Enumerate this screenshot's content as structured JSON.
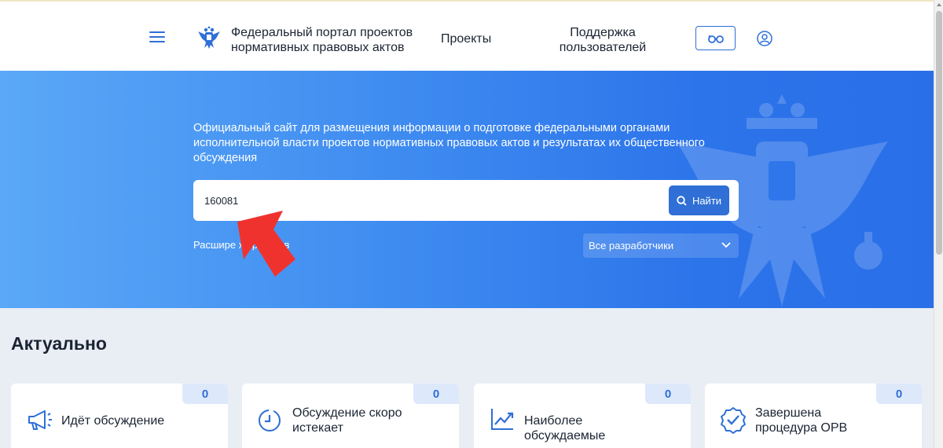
{
  "header": {
    "portal_title": "Федеральный портал проектов нормативных правовых актов",
    "nav_projects": "Проекты",
    "nav_support": "Поддержка пользователей"
  },
  "hero": {
    "description": "Официальный сайт для размещения информации о подготовке федеральными органами исполнительной власти проектов нормативных правовых актов и результатах их общественного обсуждения",
    "search_value": "160081",
    "search_button": "Найти",
    "advanced_link_visible": "Расшире                    х проектов",
    "developer_select": "Все разработчики"
  },
  "actual": {
    "title": "Актуально",
    "cards": [
      {
        "label": "Идёт обсуждение",
        "count": "0",
        "icon": "megaphone-icon"
      },
      {
        "label": "Обсуждение скоро истекает",
        "count": "0",
        "icon": "timer-icon"
      },
      {
        "label": "Наиболее обсуждаемые",
        "count": "0",
        "icon": "trending-chart-icon"
      },
      {
        "label": "Завершена процедура ОРВ",
        "count": "0",
        "icon": "check-badge-icon"
      }
    ]
  },
  "colors": {
    "accent": "#2f6fd6",
    "hero_gradient_start": "#5aa8f7",
    "hero_gradient_end": "#2a6fe8",
    "annotation_arrow": "#f0322e"
  }
}
